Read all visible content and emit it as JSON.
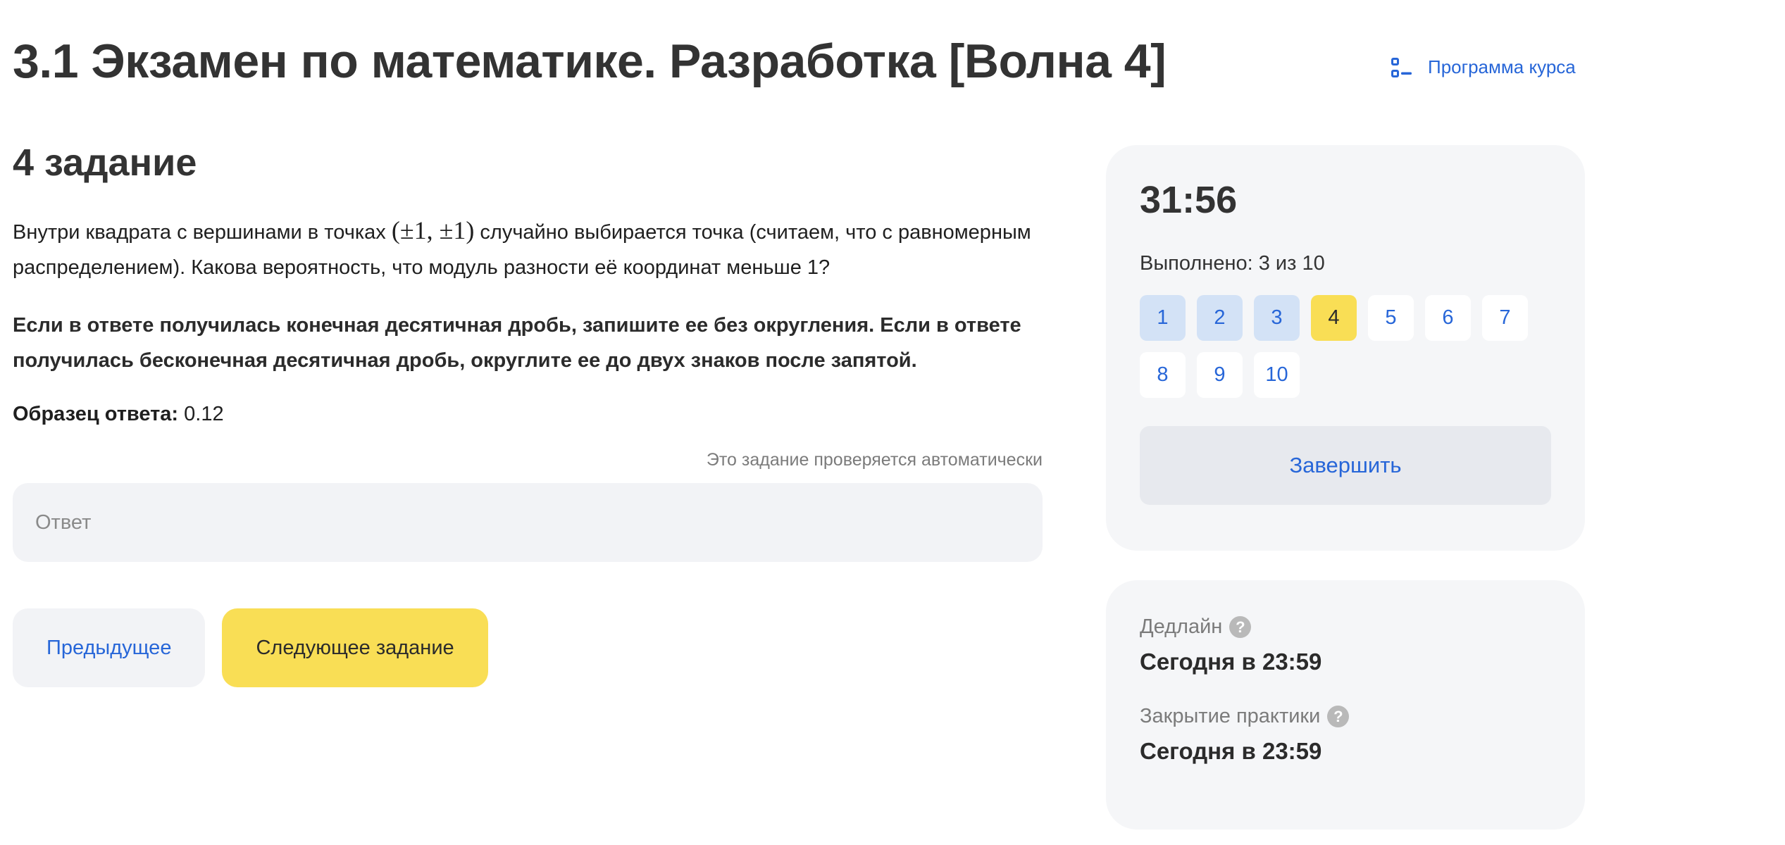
{
  "header": {
    "title": "3.1 Экзамен по математике. Разработка [Волна 4]",
    "course_program_label": "Программа курса"
  },
  "task": {
    "heading": "4 задание",
    "text_before_math": "Внутри квадрата с вершинами в точках ",
    "math": "(±1, ±1)",
    "text_after_math": " случайно выбирается точка (считаем, что с равномерным распределением). Какова вероятность, что модуль разности её координат меньше 1?",
    "note": "Если в ответе получилась конечная десятичная дробь, запишите ее без округления. Если в ответе получилась бесконечная десятичная дробь, округлите ее до двух знаков после запятой.",
    "sample_label": "Образец ответа:",
    "sample_value": "0.12",
    "auto_check": "Это задание проверяется автоматически",
    "answer_placeholder": "Ответ",
    "answer_value": ""
  },
  "navigation": {
    "prev_label": "Предыдущее",
    "next_label": "Следующее задание"
  },
  "sidebar": {
    "timer": "31:56",
    "progress_text": "Выполнено: 3 из 10",
    "tasks": [
      {
        "label": "1",
        "state": "done"
      },
      {
        "label": "2",
        "state": "done"
      },
      {
        "label": "3",
        "state": "done"
      },
      {
        "label": "4",
        "state": "current"
      },
      {
        "label": "5",
        "state": "todo"
      },
      {
        "label": "6",
        "state": "todo"
      },
      {
        "label": "7",
        "state": "todo"
      },
      {
        "label": "8",
        "state": "todo"
      },
      {
        "label": "9",
        "state": "todo"
      },
      {
        "label": "10",
        "state": "todo"
      }
    ],
    "finish_label": "Завершить",
    "deadlines": {
      "deadline_label": "Дедлайн",
      "deadline_value": "Сегодня в 23:59",
      "close_label": "Закрытие практики",
      "close_value": "Сегодня в 23:59",
      "help_icon": "question-circle-icon"
    }
  },
  "colors": {
    "accent_blue": "#2766d8",
    "accent_yellow": "#f9de55",
    "done_bg": "#d3e2f6",
    "card_bg": "#f5f6f8"
  }
}
